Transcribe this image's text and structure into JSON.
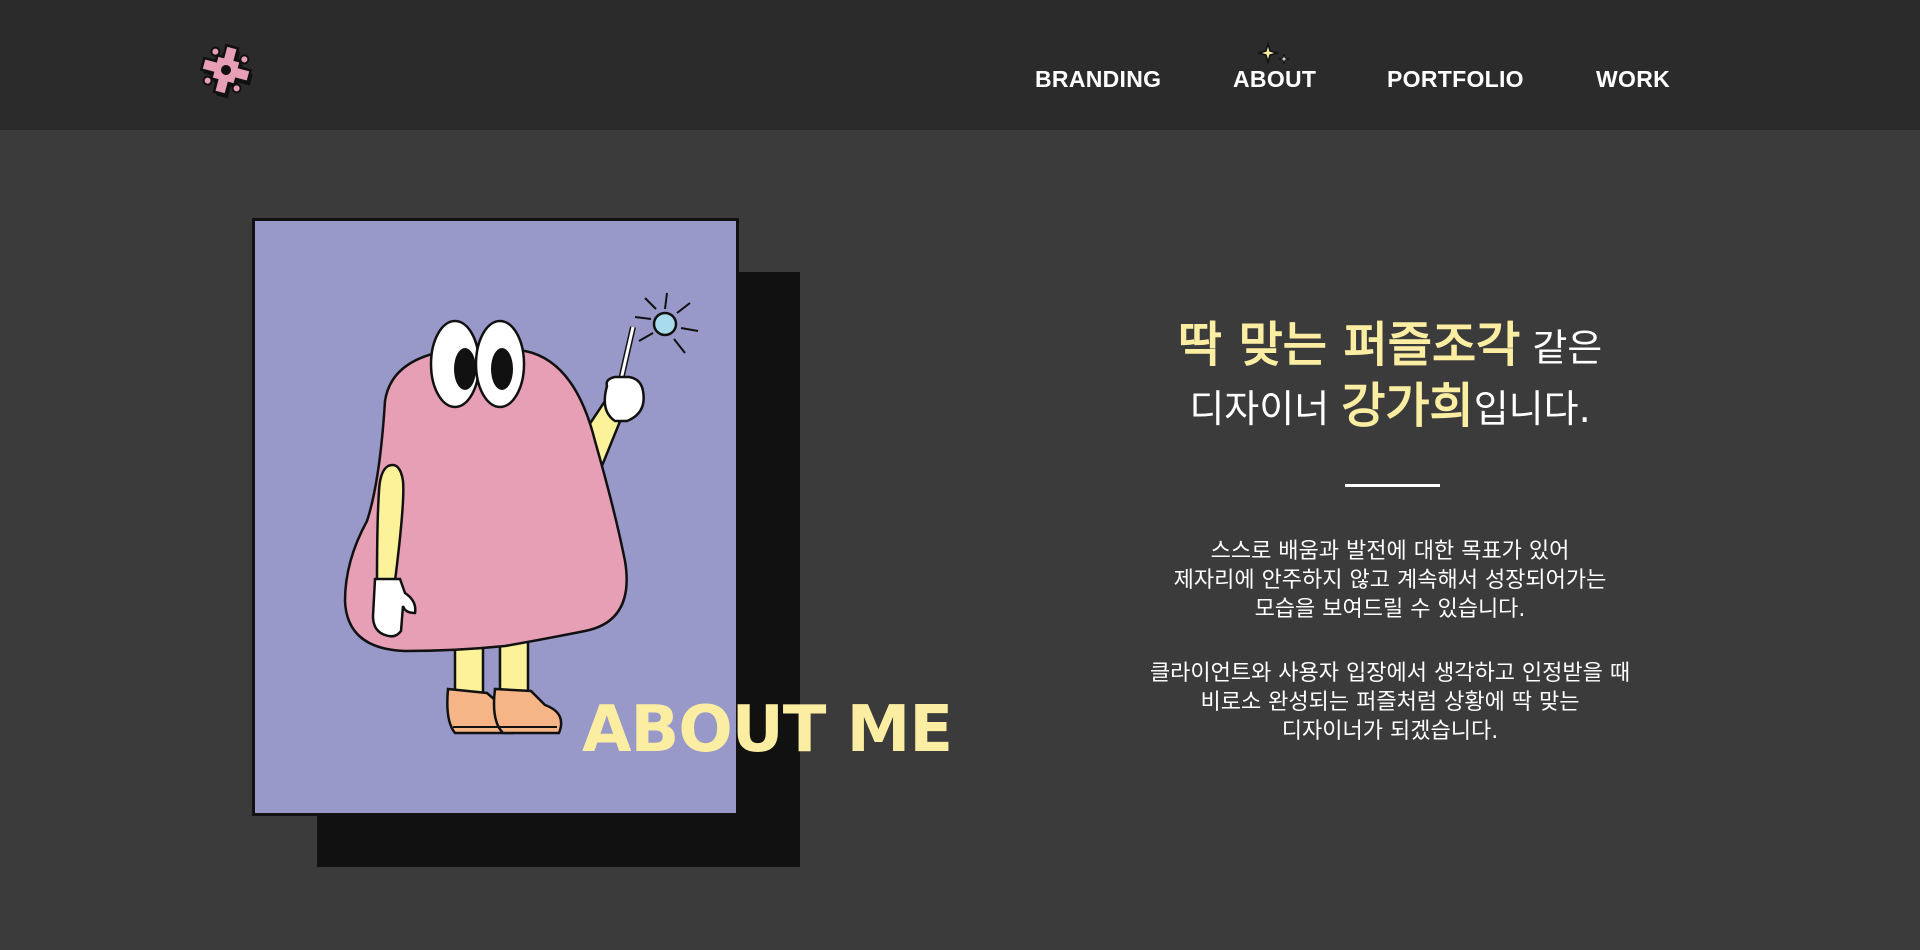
{
  "header": {
    "logo_icon": "puzzle-asterisk-icon",
    "nav": [
      {
        "label": "BRANDING"
      },
      {
        "label": "ABOUT"
      },
      {
        "label": "PORTFOLIO"
      },
      {
        "label": "WORK"
      }
    ],
    "active_indicator_icon": "sparkle-icon"
  },
  "hero": {
    "illustration": "ghost-wizard-illustration",
    "section_title": "ABOUT ME",
    "headline": {
      "line1_highlight": "딱 맞는 퍼즐조각",
      "line1_rest": " 같은",
      "line2_prefix": "디자이너 ",
      "line2_highlight": "강가희",
      "line2_suffix": "입니다."
    },
    "paragraph1": [
      "스스로 배움과 발전에 대한 목표가 있어",
      "제자리에 안주하지 않고 계속해서 성장되어가는",
      "모습을 보여드릴 수 있습니다."
    ],
    "paragraph2": [
      "클라이언트와 사용자 입장에서 생각하고 인정받을 때",
      "비로소 완성되는 퍼즐처럼 상황에 딱 맞는",
      "디자이너가 되겠습니다."
    ]
  },
  "colors": {
    "header_bg": "#2b2b2b",
    "page_bg": "#3b3b3b",
    "accent_yellow": "#fbeda1",
    "card_bg": "#9898c9",
    "character_pink": "#e79fb6",
    "logo_pink": "#e79fb6"
  }
}
